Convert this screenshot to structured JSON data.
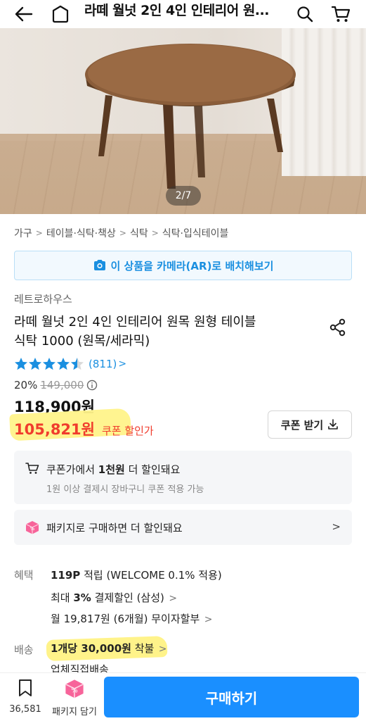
{
  "header": {
    "title": "라떼 월넛 2인 4인 인테리어 원...",
    "icons": [
      "back-arrow-icon",
      "home-icon",
      "search-icon",
      "cart-icon"
    ]
  },
  "gallery": {
    "pager": "2/7"
  },
  "breadcrumb": [
    "가구",
    "테이블·식탁·책상",
    "식탁",
    "식탁·입식테이블"
  ],
  "ar_button": {
    "label": "이 상품을 카메라(AR)로 배치해보기",
    "icon": "camera-icon",
    "color": "#1a8fe0"
  },
  "product": {
    "brand": "레트로하우스",
    "title_line1": "라떼 월넛 2인 4인 인테리어 원목 원형 테이블",
    "title_line2": "식탁 1000 (원목/세라믹)",
    "rating": {
      "stars": 4.5,
      "count": "(811)"
    },
    "discount_rate": "20%",
    "original_price": "149,000",
    "price": "118,900원",
    "coupon_price": "105,821원",
    "coupon_price_label": "쿠폰 할인가",
    "coupon_button": "쿠폰 받기"
  },
  "promo": {
    "cart_coupon_prefix": "쿠폰가에서 ",
    "cart_coupon_bold": "1천원",
    "cart_coupon_suffix": " 더 할인돼요",
    "cart_coupon_note": "1원 이상 결제시 장바구니 쿠폰 적용 가능",
    "package_text": "패키지로 구매하면 더 할인돼요"
  },
  "benefits": {
    "label": "혜택",
    "points_bold": "119P",
    "points_rest": " 적립 (WELCOME 0.1% 적용)",
    "card_prefix": "최대 ",
    "card_bold": "3%",
    "card_rest": " 결제할인 (삼성)",
    "installment": "월 19,817원 (6개월) 무이자할부"
  },
  "shipping": {
    "label": "배송",
    "fee_bold": "1개당 30,000원",
    "fee_rest": " 착불",
    "method": "업체직접배송"
  },
  "bottom": {
    "wish_count": "36,581",
    "package_label": "패키지 담기",
    "buy_label": "구매하기"
  },
  "colors": {
    "accent": "#1a8fff",
    "sale": "#f03c2d",
    "highlight": "#fff38a"
  }
}
